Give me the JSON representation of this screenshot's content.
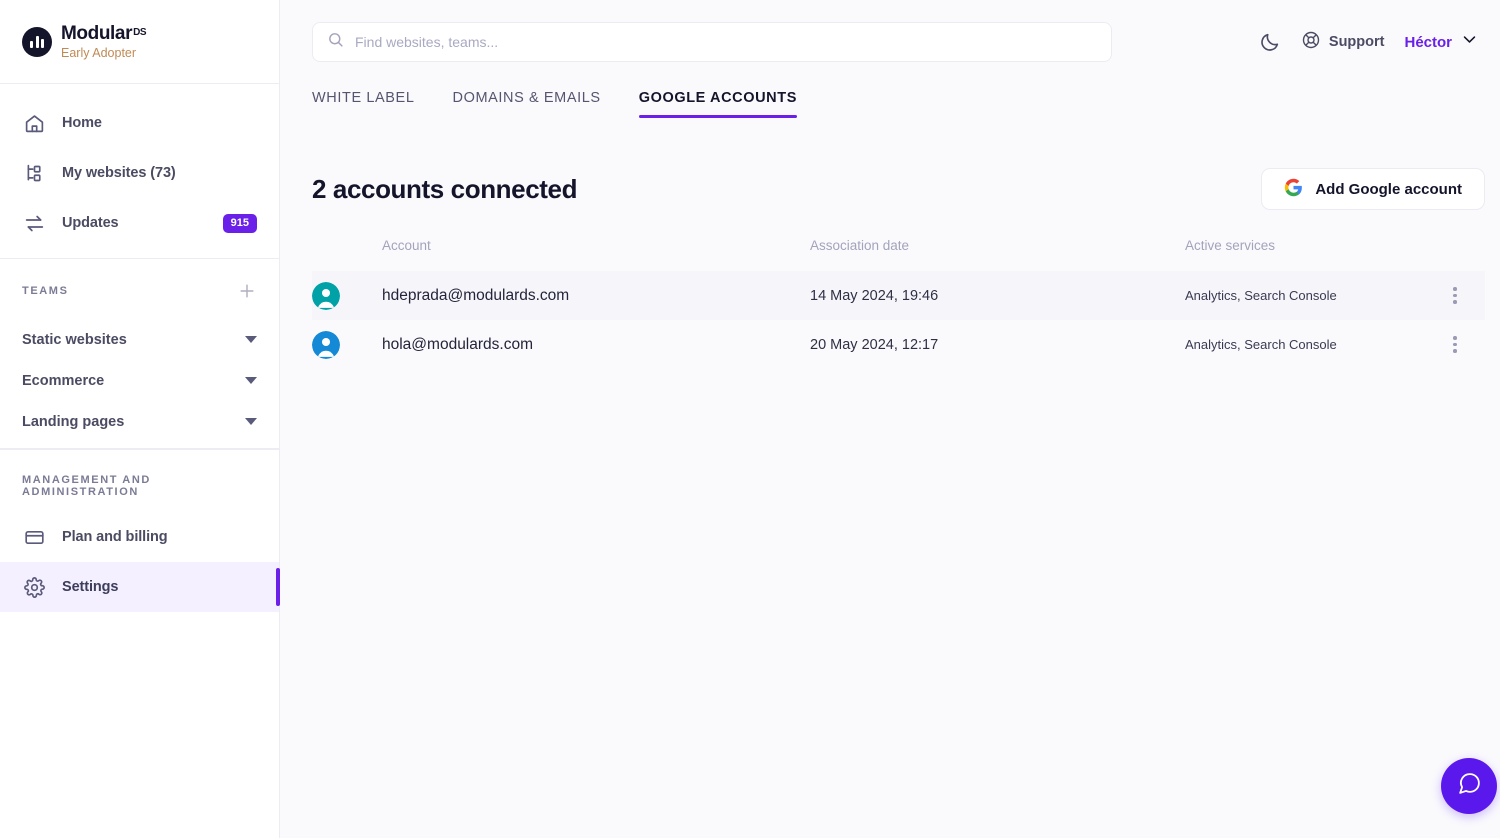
{
  "brand": {
    "name": "Modular",
    "suffix": "DS",
    "tagline": "Early Adopter",
    "logo_color": "#14142b",
    "tagline_color": "#c08a56"
  },
  "sidebar": {
    "nav": [
      {
        "label": "Home",
        "icon": "home-icon",
        "badge": ""
      },
      {
        "label": "My websites (73)",
        "icon": "sitemap-icon",
        "badge": ""
      },
      {
        "label": "Updates",
        "icon": "transfer-arrows-icon",
        "badge": "915"
      }
    ],
    "teams_section": {
      "title": "TEAMS",
      "add_icon": "plus-icon",
      "items": [
        {
          "label": "Static websites",
          "icon": "chevron-down-icon"
        },
        {
          "label": "Ecommerce",
          "icon": "chevron-down-icon"
        },
        {
          "label": "Landing pages",
          "icon": "chevron-down-icon"
        }
      ]
    },
    "management_section": {
      "title": "MANAGEMENT AND ADMINISTRATION",
      "items": [
        {
          "label": "Plan and billing",
          "icon": "credit-card-icon",
          "active": false
        },
        {
          "label": "Settings",
          "icon": "gear-icon",
          "active": true
        }
      ]
    },
    "badge_color": "#6a20e8",
    "active_indicator_color": "#6a20e8"
  },
  "topbar": {
    "search": {
      "placeholder": "Find websites, teams...",
      "value": "",
      "icon": "search-icon"
    },
    "theme_toggle_icon": "moon-icon",
    "support": {
      "label": "Support",
      "icon": "lifebuoy-icon"
    },
    "user": {
      "name": "Héctor",
      "icon": "chevron-down-icon",
      "color": "#6a20e8"
    }
  },
  "tabs": [
    {
      "label": "WHITE LABEL",
      "active": false
    },
    {
      "label": "DOMAINS & EMAILS",
      "active": false
    },
    {
      "label": "GOOGLE ACCOUNTS",
      "active": true
    }
  ],
  "main": {
    "page_title": "2 accounts connected",
    "add_account_button": {
      "label": "Add Google account",
      "icon": "google-g-icon"
    },
    "table": {
      "columns": [
        "",
        "Account",
        "Association date",
        "Active services",
        ""
      ],
      "rows": [
        {
          "avatar_color": "#00a2a8",
          "account": "hdeprada@modulards.com",
          "association_date": "14 May 2024, 19:46",
          "active_services": "Analytics, Search Console",
          "menu_icon": "kebab-menu-icon"
        },
        {
          "avatar_color": "#1489d6",
          "account": "hola@modulards.com",
          "association_date": "20 May 2024, 12:17",
          "active_services": "Analytics, Search Console",
          "menu_icon": "kebab-menu-icon"
        }
      ]
    }
  },
  "fab": {
    "icon": "chat-bubble-icon",
    "color": "#5b18ec"
  }
}
